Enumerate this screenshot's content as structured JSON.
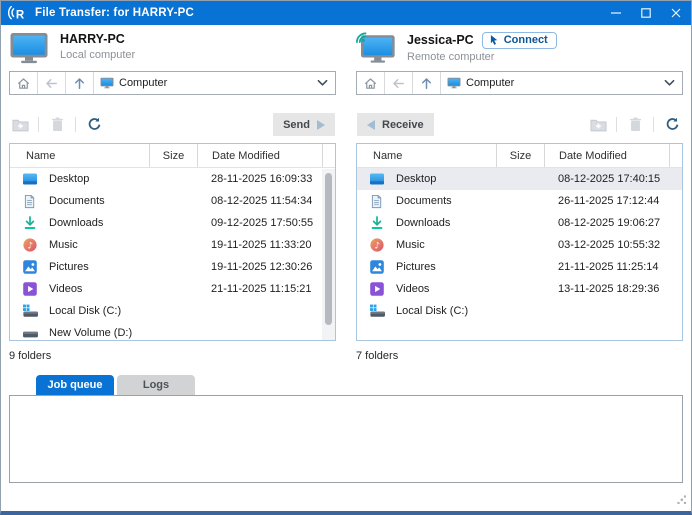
{
  "window": {
    "title": "File Transfer: for HARRY-PC"
  },
  "colors": {
    "titlebar": "#0873d4",
    "tab_active": "#0873d4",
    "selection": "#e9ebf1",
    "list_border": "#a9c6e1"
  },
  "icons": [
    "app-signal-logo",
    "minimize-icon",
    "maximize-icon",
    "close-icon",
    "monitor-icon",
    "remote-monitor-icon",
    "cursor-icon",
    "home-icon",
    "back-arrow-icon",
    "up-arrow-icon",
    "chevron-down-icon",
    "new-folder-icon",
    "trash-icon",
    "refresh-icon",
    "send-triangle-icon",
    "receive-triangle-icon",
    "desktop-icon",
    "documents-icon",
    "downloads-icon",
    "music-icon",
    "pictures-icon",
    "videos-icon",
    "system-drive-icon",
    "drive-icon"
  ],
  "local_panel": {
    "computer_name": "HARRY-PC",
    "computer_type": "Local computer",
    "breadcrumb": "Computer",
    "transfer_button": "Send",
    "columns": [
      "Name",
      "Size",
      "Date Modified"
    ],
    "rows": [
      {
        "icon": "desktop-icon",
        "name": "Desktop",
        "size": "",
        "date": "28-11-2025 16:09:33"
      },
      {
        "icon": "documents-icon",
        "name": "Documents",
        "size": "",
        "date": "08-12-2025 11:54:34"
      },
      {
        "icon": "downloads-icon",
        "name": "Downloads",
        "size": "",
        "date": "09-12-2025 17:50:55"
      },
      {
        "icon": "music-icon",
        "name": "Music",
        "size": "",
        "date": "19-11-2025 11:33:20"
      },
      {
        "icon": "pictures-icon",
        "name": "Pictures",
        "size": "",
        "date": "19-11-2025 12:30:26"
      },
      {
        "icon": "videos-icon",
        "name": "Videos",
        "size": "",
        "date": "21-11-2025 11:15:21"
      },
      {
        "icon": "system-drive-icon",
        "name": "Local Disk (C:)",
        "size": "",
        "date": ""
      },
      {
        "icon": "drive-icon",
        "name": "New Volume (D:)",
        "size": "",
        "date": ""
      }
    ],
    "status": "9 folders"
  },
  "remote_panel": {
    "computer_name": "Jessica-PC",
    "computer_type": "Remote computer",
    "connect_button": "Connect",
    "breadcrumb": "Computer",
    "transfer_button": "Receive",
    "columns": [
      "Name",
      "Size",
      "Date Modified"
    ],
    "rows": [
      {
        "icon": "desktop-icon",
        "name": "Desktop",
        "size": "",
        "date": "08-12-2025 17:40:15",
        "selected": true
      },
      {
        "icon": "documents-icon",
        "name": "Documents",
        "size": "",
        "date": "26-11-2025 17:12:44"
      },
      {
        "icon": "downloads-icon",
        "name": "Downloads",
        "size": "",
        "date": "08-12-2025 19:06:27"
      },
      {
        "icon": "music-icon",
        "name": "Music",
        "size": "",
        "date": "03-12-2025 10:55:32"
      },
      {
        "icon": "pictures-icon",
        "name": "Pictures",
        "size": "",
        "date": "21-11-2025 11:25:14"
      },
      {
        "icon": "videos-icon",
        "name": "Videos",
        "size": "",
        "date": "13-11-2025 18:29:36"
      },
      {
        "icon": "system-drive-icon",
        "name": "Local Disk (C:)",
        "size": "",
        "date": ""
      }
    ],
    "status": "7 folders"
  },
  "bottom": {
    "tabs": [
      {
        "label": "Job queue",
        "active": true
      },
      {
        "label": "Logs",
        "active": false
      }
    ]
  }
}
